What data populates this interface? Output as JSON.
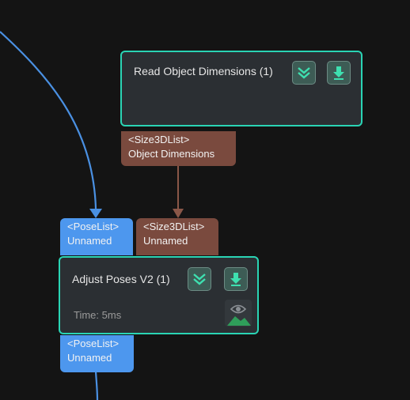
{
  "nodes": {
    "read_object_dimensions": {
      "title": "Read Object Dimensions (1)",
      "output_port": {
        "type": "<Size3DList>",
        "name": "Object Dimensions"
      }
    },
    "adjust_poses": {
      "title": "Adjust Poses V2 (1)",
      "time": "Time: 5ms",
      "input_ports": [
        {
          "type": "<PoseList>",
          "name": "Unnamed"
        },
        {
          "type": "<Size3DList>",
          "name": "Unnamed"
        }
      ],
      "output_port": {
        "type": "<PoseList>",
        "name": "Unnamed"
      }
    }
  },
  "icons": {
    "collapse": "double-chevron-down-icon",
    "debug_output": "download-arrow-icon",
    "visualize": "eye-landscape-icon"
  },
  "colors": {
    "canvas_bg": "#141414",
    "node_bg": "#2b2f33",
    "node_border": "#2ad4b4",
    "pose_port": "#4d97ee",
    "size_port": "#7a4a3e",
    "pose_connection": "#4a90e2",
    "size_connection": "#8a5748"
  }
}
